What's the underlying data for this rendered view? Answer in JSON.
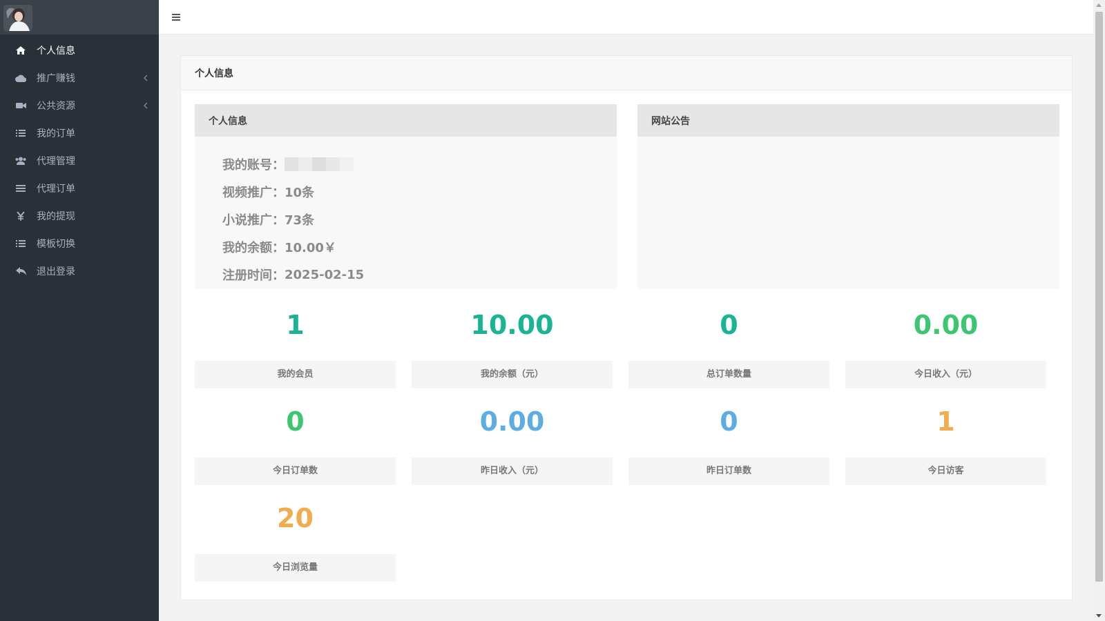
{
  "sidebar": {
    "items": [
      {
        "label": "个人信息",
        "icon": "home-icon",
        "active": true,
        "arrow": false
      },
      {
        "label": "推广赚钱",
        "icon": "cloud-icon",
        "active": false,
        "arrow": true
      },
      {
        "label": "公共资源",
        "icon": "video-camera-icon",
        "active": false,
        "arrow": true
      },
      {
        "label": "我的订单",
        "icon": "list-icon",
        "active": false,
        "arrow": false
      },
      {
        "label": "代理管理",
        "icon": "users-icon",
        "active": false,
        "arrow": false
      },
      {
        "label": "代理订单",
        "icon": "bars-icon",
        "active": false,
        "arrow": false
      },
      {
        "label": "我的提现",
        "icon": "yen-icon",
        "active": false,
        "arrow": false
      },
      {
        "label": "模板切换",
        "icon": "list-icon",
        "active": false,
        "arrow": false
      },
      {
        "label": "退出登录",
        "icon": "reply-icon",
        "active": false,
        "arrow": false
      }
    ]
  },
  "panel": {
    "title": "个人信息"
  },
  "profile_card": {
    "title": "个人信息",
    "rows": [
      {
        "label": "我的账号：",
        "value": ""
      },
      {
        "label": "视频推广：",
        "value": "10条"
      },
      {
        "label": "小说推广：",
        "value": "73条"
      },
      {
        "label": "我的余额：",
        "value": "10.00￥"
      },
      {
        "label": "注册时间：",
        "value": "2025-02-15"
      }
    ]
  },
  "notice_card": {
    "title": "网站公告"
  },
  "stats": [
    {
      "value": "1",
      "label": "我的会员",
      "color": "#1ab394"
    },
    {
      "value": "10.00",
      "label": "我的余额（元）",
      "color": "#1ab394"
    },
    {
      "value": "0",
      "label": "总订单数量",
      "color": "#1ab394"
    },
    {
      "value": "0.00",
      "label": "今日收入（元）",
      "color": "#3cc66f"
    },
    {
      "value": "0",
      "label": "今日订单数",
      "color": "#3cc66f"
    },
    {
      "value": "0.00",
      "label": "昨日收入（元）",
      "color": "#5dade2"
    },
    {
      "value": "0",
      "label": "昨日订单数",
      "color": "#5dade2"
    },
    {
      "value": "1",
      "label": "今日访客",
      "color": "#f0ad4e"
    },
    {
      "value": "20",
      "label": "今日浏览量",
      "color": "#f0ad4e"
    }
  ]
}
